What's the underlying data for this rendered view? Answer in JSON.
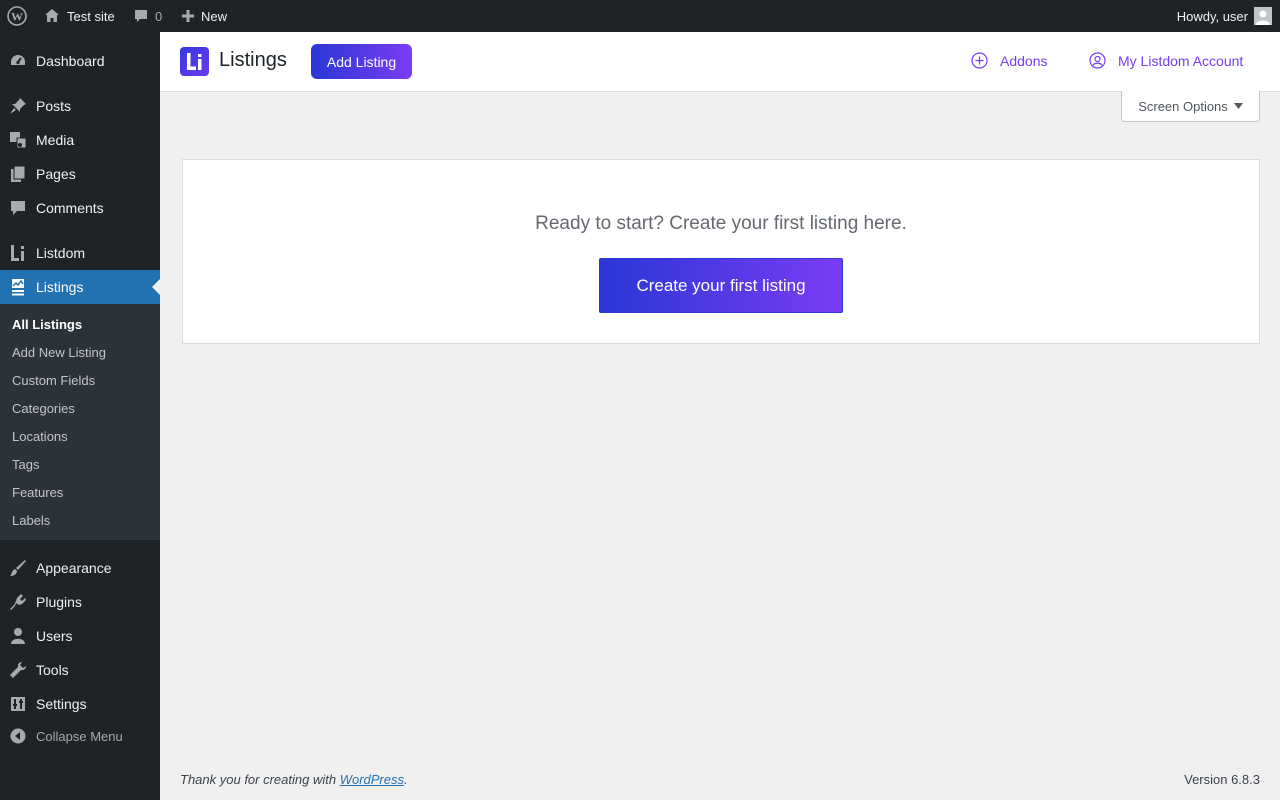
{
  "adminbar": {
    "site_name": "Test site",
    "comments_count": "0",
    "new_label": "New",
    "howdy": "Howdy, user"
  },
  "sidebar": {
    "items": [
      {
        "label": "Dashboard",
        "icon": "dashboard-icon"
      },
      {
        "label": "Posts",
        "icon": "pin-icon"
      },
      {
        "label": "Media",
        "icon": "media-icon"
      },
      {
        "label": "Pages",
        "icon": "pages-icon"
      },
      {
        "label": "Comments",
        "icon": "comment-icon"
      },
      {
        "label": "Listdom",
        "icon": "listdom-icon"
      },
      {
        "label": "Listings",
        "icon": "listings-icon"
      },
      {
        "label": "Appearance",
        "icon": "brush-icon"
      },
      {
        "label": "Plugins",
        "icon": "plugin-icon"
      },
      {
        "label": "Users",
        "icon": "user-icon"
      },
      {
        "label": "Tools",
        "icon": "wrench-icon"
      },
      {
        "label": "Settings",
        "icon": "settings-icon"
      }
    ],
    "submenu": [
      "All Listings",
      "Add New Listing",
      "Custom Fields",
      "Categories",
      "Locations",
      "Tags",
      "Features",
      "Labels"
    ],
    "collapse_label": "Collapse Menu"
  },
  "header": {
    "title": "Listings",
    "add_listing_label": "Add Listing",
    "addons_label": "Addons",
    "account_label": "My Listdom Account"
  },
  "screen_options_label": "Screen Options",
  "empty_state": {
    "message": "Ready to start? Create your first listing here.",
    "button_label": "Create your first listing"
  },
  "footer": {
    "thanks_prefix": "Thank you for creating with ",
    "thanks_link": "WordPress",
    "thanks_suffix": ".",
    "version": "Version 6.8.3"
  },
  "colors": {
    "admin_dark": "#1d2327",
    "submenu_bg": "#2c3338",
    "current_blue": "#2271b1",
    "brand_gradient_start": "#2a37d6",
    "brand_gradient_end": "#7a3cf3"
  }
}
